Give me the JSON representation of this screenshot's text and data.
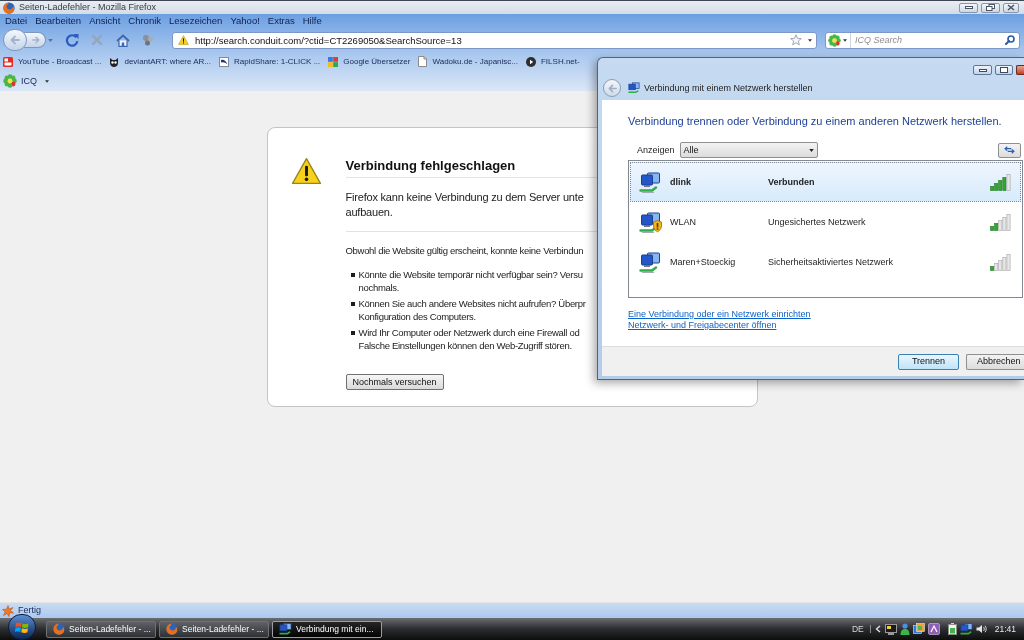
{
  "window": {
    "title": "Seiten-Ladefehler - Mozilla Firefox"
  },
  "menu": [
    "Datei",
    "Bearbeiten",
    "Ansicht",
    "Chronik",
    "Lesezeichen",
    "Yahoo!",
    "Extras",
    "Hilfe"
  ],
  "address_bar": {
    "value": "http://search.conduit.com/?ctid=CT2269050&SearchSource=13"
  },
  "search": {
    "placeholder": "ICQ Search"
  },
  "bookmarks": [
    {
      "label": "YouTube - Broadcast ...",
      "kind": "video"
    },
    {
      "label": "deviantART: where AR...",
      "kind": "mascot"
    },
    {
      "label": "RapidShare: 1-CLICK ...",
      "kind": "swoosh"
    },
    {
      "label": "Google Übersetzer",
      "kind": "tiles"
    },
    {
      "label": "Wadoku.de - Japanisc...",
      "kind": "page"
    },
    {
      "label": "FILSH.net-",
      "kind": "play"
    }
  ],
  "icq_toolbar": {
    "label": "ICQ"
  },
  "error_page": {
    "title": "Verbindung fehlgeschlagen",
    "intro": [
      "Firefox kann keine Verbindung zu dem Server unte",
      "aufbauen."
    ],
    "detail": "Obwohl die Website gültig erscheint, konnte keine Verbindun",
    "bullets": [
      {
        "lines": [
          "Könnte die Website temporär nicht verfügbar sein? Versu",
          "nochmals."
        ]
      },
      {
        "lines": [
          "Können Sie auch andere Websites nicht aufrufen? Überpr",
          "Konfiguration des Computers."
        ]
      },
      {
        "lines": [
          "Wird Ihr Computer oder Netzwerk durch eine Firewall od",
          "Falsche Einstellungen können den Web-Zugriff stören."
        ]
      }
    ],
    "button": "Nochmals versuchen"
  },
  "status_bar": {
    "text": "Fertig"
  },
  "dialog": {
    "title": "Verbindung mit einem Netzwerk herstellen",
    "heading": "Verbindung trennen oder Verbindung zu einem anderen Netzwerk herstellen.",
    "filter": {
      "label": "Anzeigen",
      "value": "Alle"
    },
    "networks": [
      {
        "name": "dlink",
        "status": "Verbunden",
        "selected": true,
        "unsecured": false,
        "signal_icon": {
          "kind": "strong"
        }
      },
      {
        "name": "WLAN",
        "status": "Ungesichertes Netzwerk",
        "selected": false,
        "unsecured": true,
        "signal_icon": {
          "kind": "medium"
        }
      },
      {
        "name": "Maren+Stoeckig",
        "status": "Sicherheitsaktiviertes Netzwerk",
        "selected": false,
        "unsecured": false,
        "signal_icon": {
          "kind": "weak"
        }
      }
    ],
    "links": [
      "Eine Verbindung oder ein Netzwerk einrichten",
      "Netzwerk- und Freigabecenter öffnen"
    ],
    "buttons": [
      {
        "label": "Trennen",
        "default": true
      },
      {
        "label": "Abbrechen",
        "default": false
      }
    ]
  },
  "taskbar": {
    "items": [
      {
        "label": "Seiten-Ladefehler - ...",
        "kind": "browser",
        "selected": false
      },
      {
        "label": "Seiten-Ladefehler - ...",
        "kind": "browser",
        "selected": false
      },
      {
        "label": "Verbindung mit ein...",
        "kind": "network",
        "selected": true
      }
    ],
    "language": "DE",
    "clock": "21:41"
  }
}
